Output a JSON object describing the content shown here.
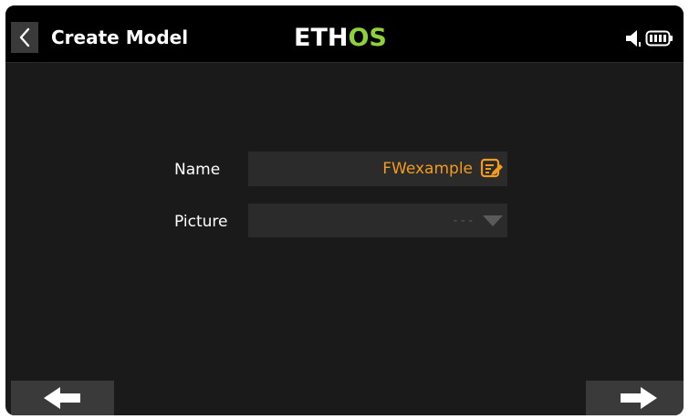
{
  "header": {
    "title": "Create Model",
    "brand_part1": "ETH",
    "brand_part2": "OS",
    "back_icon": "chevron-left-icon",
    "status_icons": [
      "speaker-icon",
      "battery-icon"
    ]
  },
  "form": {
    "name_label": "Name",
    "name_value": "FWexample",
    "name_edit_icon": "edit-icon",
    "picture_label": "Picture",
    "picture_value": "---",
    "picture_dropdown_icon": "dropdown-triangle-icon"
  },
  "footer": {
    "prev_icon": "arrow-left-icon",
    "next_icon": "arrow-right-icon"
  },
  "colors": {
    "accent": "#f29b1e",
    "brand_green": "#8ed13a",
    "background": "#1a1a1a",
    "header_background": "#000000",
    "field_background": "#2b2b2b"
  }
}
